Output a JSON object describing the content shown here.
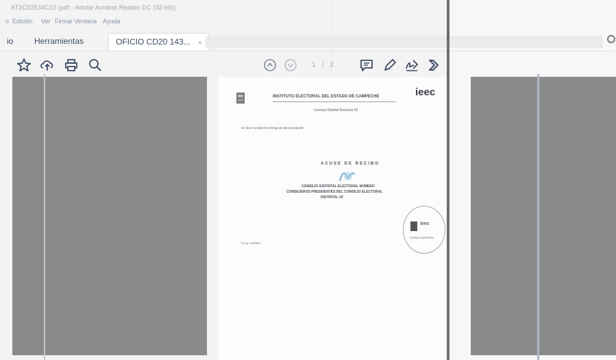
{
  "window": {
    "title": "AT3C02534C12 (pdf - Adobe Acrobat Reader DC (32-bit))"
  },
  "menu": {
    "items": [
      "Edición",
      "Ver",
      "Firmar",
      "Ventana",
      "Ayuda"
    ],
    "cut_prefix": "o"
  },
  "tabs": {
    "start_cut": "io",
    "tools_label": "Herramientas",
    "document_tab": "OFICIO CD20 143...",
    "close_glyph": "×"
  },
  "toolbar": {
    "page_current": "1",
    "page_total": "/ 2"
  },
  "document": {
    "header_text": "INSTITUTO ELECTORAL DEL ESTADO DE CAMPECHE",
    "logo_text": "ieec",
    "subheader": "Consejo Distrital Electoral 20",
    "intro_line": "Se hace constar la entrega de documentación",
    "received_label": "ACUSE DE RECIBO",
    "body_line_1": "CONSEJO DISTRITAL ELECTORAL NÚMERO",
    "body_line_2": "CONSEJEROS PRESIDENTES DEL CONSEJO ELECTORAL",
    "body_line_3": "DISTRITAL 20",
    "stamp_logo": "ieec",
    "stamp_text": "CONSEJO DISTRITAL",
    "footer_text": "C.c.p. Archivo"
  },
  "colors": {
    "accent": "#3c4a63",
    "panel_gray": "#8a8a8a",
    "divider": "#6f6f6f"
  }
}
